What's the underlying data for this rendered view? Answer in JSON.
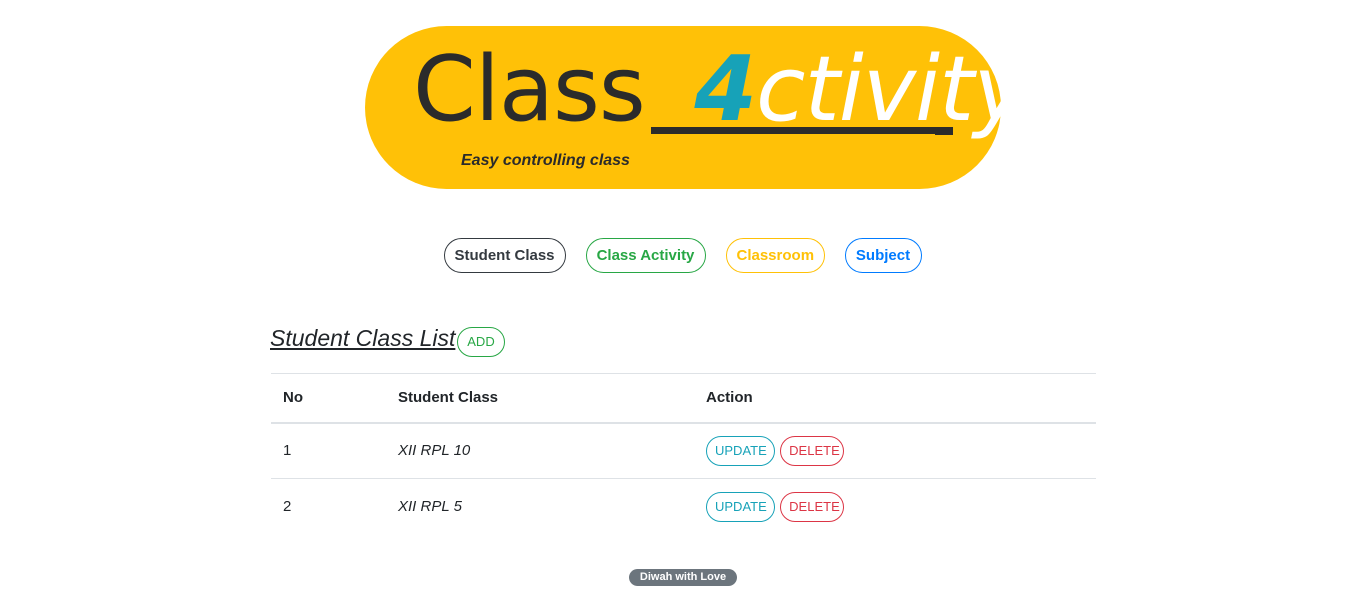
{
  "logo": {
    "word1": "Class ",
    "digit": "4",
    "word2": "ctivity",
    "tagline": "Easy controlling class"
  },
  "nav": [
    {
      "label": "Student Class"
    },
    {
      "label": "Class Activity"
    },
    {
      "label": "Classroom"
    },
    {
      "label": "Subject"
    }
  ],
  "section": {
    "title": "Student Class List",
    "add_label": "ADD"
  },
  "table": {
    "headers": [
      "No",
      "Student Class",
      "Action"
    ],
    "rows": [
      {
        "no": "1",
        "student_class": "XII RPL 10",
        "update_label": "UPDATE",
        "delete_label": "DELETE"
      },
      {
        "no": "2",
        "student_class": "XII RPL 5",
        "update_label": "UPDATE",
        "delete_label": "DELETE"
      }
    ]
  },
  "footer": {
    "badge": "Diwah with Love"
  },
  "colors": {
    "logo_bg": "#ffc107",
    "accent_teal": "#17a2b8",
    "green": "#28a745",
    "blue": "#007bff",
    "red": "#dc3545",
    "dark": "#343a40",
    "badge_gray": "#6c757d"
  }
}
